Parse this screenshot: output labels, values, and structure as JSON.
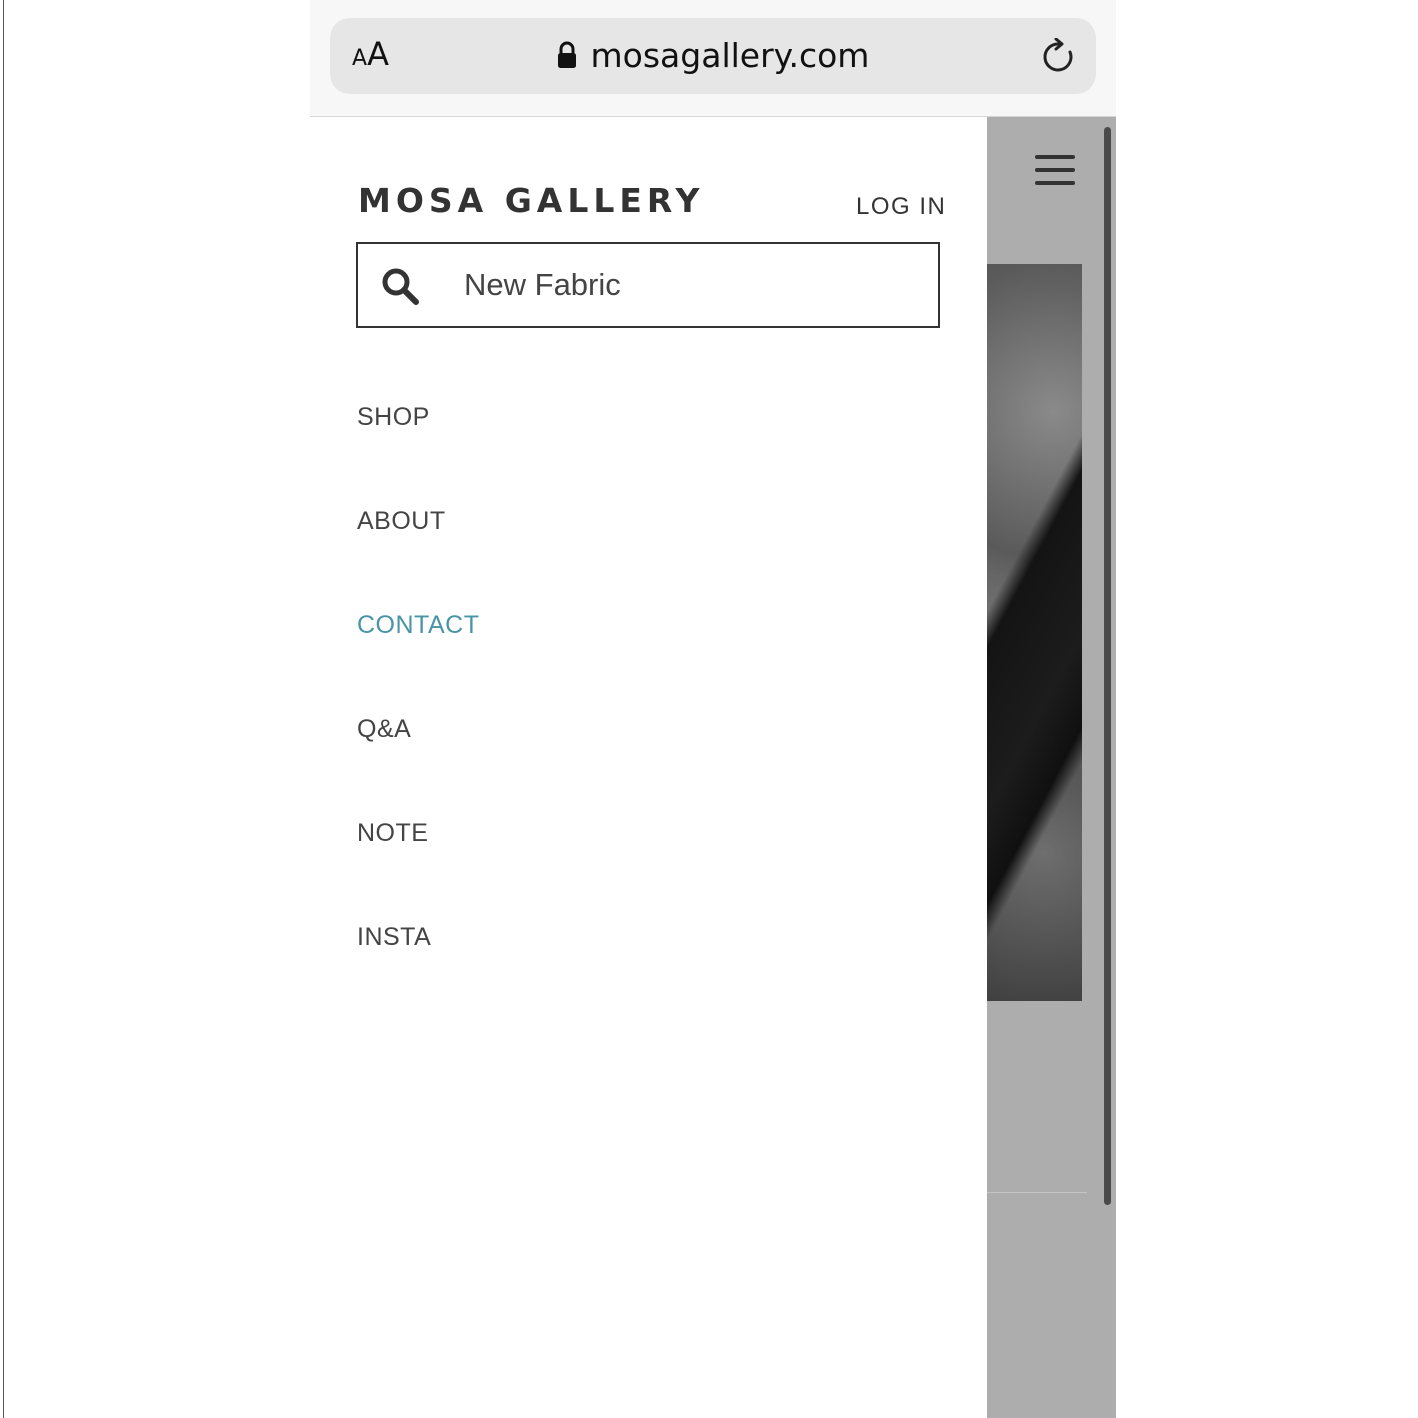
{
  "browser": {
    "text_size_small": "A",
    "text_size_large": "A",
    "address": "mosagallery.com",
    "icons": {
      "lock": "lock-icon",
      "reload": "reload-icon"
    }
  },
  "site": {
    "brand": "MOSA GALLERY",
    "login_label": "LOG IN",
    "search": {
      "value": "New Fabric",
      "icon": "search-icon"
    },
    "menu_icon": "hamburger-icon"
  },
  "nav": {
    "items": [
      {
        "label": "SHOP"
      },
      {
        "label": "ABOUT"
      },
      {
        "label": "CONTACT",
        "active": true
      },
      {
        "label": "Q&A"
      },
      {
        "label": "NOTE"
      },
      {
        "label": "INSTA"
      }
    ]
  },
  "colors": {
    "accent": "#4a94a6",
    "text": "#444444",
    "overlay": "#b2b2b2"
  }
}
